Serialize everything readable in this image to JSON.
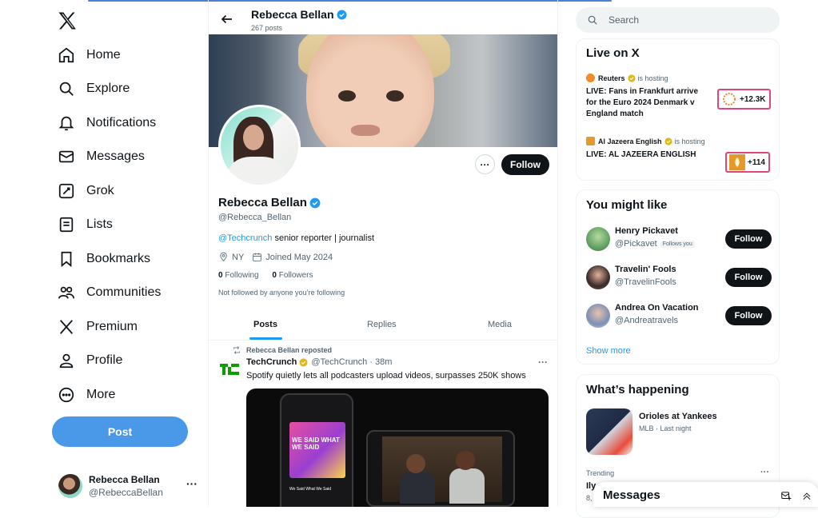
{
  "nav": {
    "logo": "x-logo-icon",
    "items": [
      {
        "label": "Home",
        "icon": "home-icon"
      },
      {
        "label": "Explore",
        "icon": "search-icon"
      },
      {
        "label": "Notifications",
        "icon": "bell-icon"
      },
      {
        "label": "Messages",
        "icon": "mail-icon"
      },
      {
        "label": "Grok",
        "icon": "grok-icon"
      },
      {
        "label": "Lists",
        "icon": "list-icon"
      },
      {
        "label": "Bookmarks",
        "icon": "bookmark-icon"
      },
      {
        "label": "Communities",
        "icon": "people-icon"
      },
      {
        "label": "Premium",
        "icon": "x-premium-icon"
      },
      {
        "label": "Profile",
        "icon": "person-icon"
      },
      {
        "label": "More",
        "icon": "more-circle-icon"
      }
    ],
    "post_label": "Post",
    "account": {
      "name": "Rebecca Bellan",
      "handle": "@RebeccaBellan",
      "more": "···"
    }
  },
  "header": {
    "name": "Rebecca Bellan",
    "posts": "267 posts"
  },
  "profile": {
    "name": "Rebecca Bellan",
    "handle": "@Rebecca_Bellan",
    "bio_link": "@Techcrunch",
    "bio_text": " senior reporter | journalist",
    "location": "NY",
    "joined": "Joined May 2024",
    "following_count": "0",
    "following_label": "Following",
    "followers_count": "0",
    "followers_label": "Followers",
    "not_followed": "Not followed by anyone you’re following",
    "follow_label": "Follow",
    "more_label": "···"
  },
  "tabs": [
    {
      "label": "Posts",
      "active": true
    },
    {
      "label": "Replies",
      "active": false
    },
    {
      "label": "Media",
      "active": false
    }
  ],
  "tweet": {
    "repost_text": "Rebecca Bellan reposted",
    "source": "TechCrunch",
    "handle_time": "@TechCrunch · 38m",
    "text": "Spotify quietly lets all podcasters upload videos, surpasses 250K shows",
    "more": "···",
    "media": {
      "cover_text": "WE SAID WHAT WE SAID",
      "episode": "We Said What We Said"
    }
  },
  "search": {
    "placeholder": "Search"
  },
  "live": {
    "title": "Live on X",
    "items": [
      {
        "host": "Reuters",
        "hosting": "is hosting",
        "title": "LIVE: Fans in Frankfurt arrive for the Euro 2024 Denmark v England match",
        "count": "+12.3K",
        "color": "#f08a2b"
      },
      {
        "host": "Al Jazeera English",
        "hosting": "is hosting",
        "title": "LIVE: AL JAZEERA ENGLISH",
        "count": "+114",
        "color": "#e49a2a"
      }
    ]
  },
  "suggest": {
    "title": "You might like",
    "items": [
      {
        "name": "Henry Pickavet",
        "handle": "@Pickavet",
        "badge": "Follows you",
        "follow": "Follow"
      },
      {
        "name": "Travelin' Fools",
        "handle": "@TravelinFools",
        "badge": "",
        "follow": "Follow"
      },
      {
        "name": "Andrea On Vacation",
        "handle": "@Andreatravels",
        "badge": "",
        "follow": "Follow"
      }
    ],
    "show_more": "Show more"
  },
  "happening": {
    "title": "What’s happening",
    "event": {
      "title": "Orioles at Yankees",
      "meta": "MLB · Last night"
    },
    "trend": {
      "label": "Trending",
      "title": "Ily",
      "count": "8,"
    },
    "more": "···"
  },
  "messages_bar": {
    "title": "Messages"
  },
  "colors": {
    "accent": "#1d9bf0",
    "post_button": "#4a99e9",
    "live_border": "#e0457b"
  }
}
